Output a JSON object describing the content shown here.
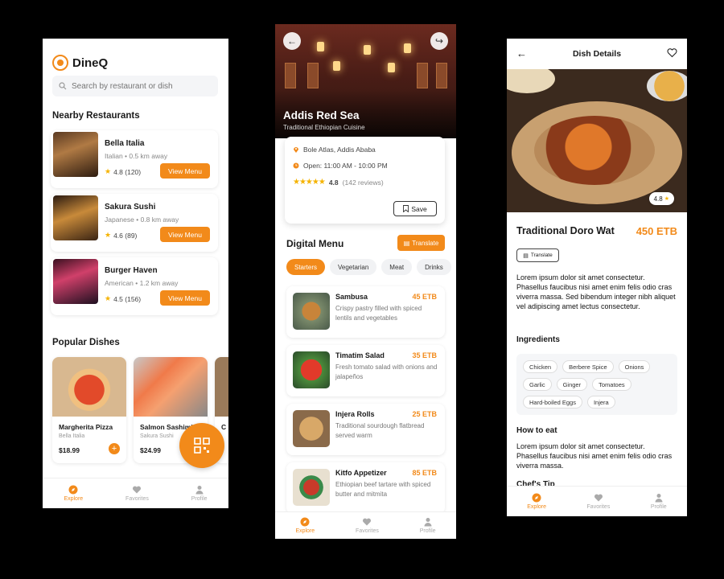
{
  "explore": {
    "logo": "DineQ",
    "search_placeholder": "Search by restaurant or dish",
    "nearby_title": "Nearby Restaurants",
    "restaurants": [
      {
        "name": "Bella Italia",
        "meta": "Italian • 0.5 km away",
        "rating": "4.8 (120)",
        "button": "View Menu"
      },
      {
        "name": "Sakura Sushi",
        "meta": "Japanese • 0.8 km away",
        "rating": "4.6 (89)",
        "button": "View Menu"
      },
      {
        "name": "Burger Haven",
        "meta": "American • 1.2 km away",
        "rating": "4.5 (156)",
        "button": "View Menu"
      }
    ],
    "popular_title": "Popular Dishes",
    "dishes": [
      {
        "name": "Margherita Pizza",
        "restaurant": "Bella Italia",
        "price": "$18.99"
      },
      {
        "name": "Salmon Sashimi",
        "restaurant": "Sakura Sushi",
        "price": "$24.99"
      },
      {
        "name": "C"
      }
    ],
    "nav": [
      "Explore",
      "Favorites",
      "Profile"
    ]
  },
  "restaurant": {
    "name": "Addis Red Sea",
    "cuisine": "Traditional Ethiopian Cuisine",
    "address": "Bole Atlas, Addis Ababa",
    "hours": "Open: 11:00 AM - 10:00 PM",
    "rating": "4.8",
    "reviews": "(142 reviews)",
    "save": "Save",
    "menu_title": "Digital Menu",
    "translate": "Translate",
    "categories": [
      "Starters",
      "Vegetarian",
      "Meat",
      "Drinks"
    ],
    "items": [
      {
        "name": "Sambusa",
        "price": "45 ETB",
        "desc": "Crispy pastry filled with spiced lentils and vegetables"
      },
      {
        "name": "Timatim Salad",
        "price": "35 ETB",
        "desc": "Fresh tomato salad with onions and jalapeños"
      },
      {
        "name": "Injera Rolls",
        "price": "25 ETB",
        "desc": "Traditional sourdough flatbread served warm"
      },
      {
        "name": "Kitfo Appetizer",
        "price": "85 ETB",
        "desc": "Ethiopian beef tartare with spiced butter and mitmita"
      }
    ],
    "nav": [
      "Explore",
      "Favorites",
      "Profile"
    ]
  },
  "dish": {
    "header": "Dish Details",
    "rating": "4.8",
    "title": "Traditional Doro Wat",
    "price": "450 ETB",
    "translate": "Translate",
    "description": "Lorem ipsum dolor sit amet consectetur. Phasellus faucibus nisi amet enim felis odio cras viverra massa. Sed bibendum integer nibh aliquet vel adipiscing amet lectus consectetur.",
    "ingredients_title": "Ingredients",
    "ingredients": [
      "Chicken",
      "Berbere Spice",
      "Onions",
      "Garlic",
      "Ginger",
      "Tomatoes",
      "Hard-boiled Eggs",
      "Injera"
    ],
    "how_title": "How to eat",
    "how_text": "Lorem ipsum dolor sit amet consectetur. Phasellus faucibus nisi amet enim felis odio cras viverra massa.",
    "tip_title": "Chef's Tip",
    "nav": [
      "Explore",
      "Favorites",
      "Profile"
    ]
  },
  "colors": {
    "accent": "#f28a1a",
    "star": "#f5b301"
  }
}
